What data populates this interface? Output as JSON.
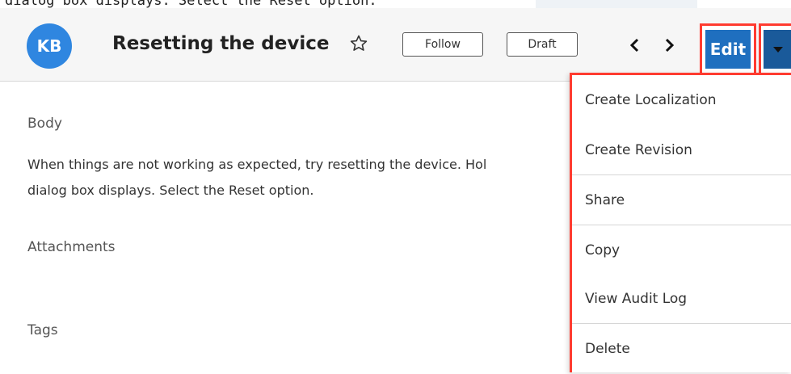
{
  "caption": "dialog box displays. Select the Reset option.",
  "header": {
    "avatar_initials": "KB",
    "title": "Resetting the device",
    "follow_label": "Follow",
    "status_label": "Draft",
    "edit_label": "Edit",
    "accent_color": "#1f6fbf",
    "highlight_color": "#ff3b30"
  },
  "record": {
    "body_label": "Body",
    "body_text_line1": "When things are not working as expected, try resetting the device. Hol",
    "body_text_line2": "dialog box displays. Select the Reset option.",
    "attachments_label": "Attachments",
    "tags_label": "Tags"
  },
  "actions_menu": {
    "items": [
      {
        "label": "Create Localization"
      },
      {
        "label": "Create Revision"
      },
      {
        "label": "Share"
      },
      {
        "label": "Copy"
      },
      {
        "label": "View Audit Log"
      },
      {
        "label": "Delete"
      }
    ]
  }
}
